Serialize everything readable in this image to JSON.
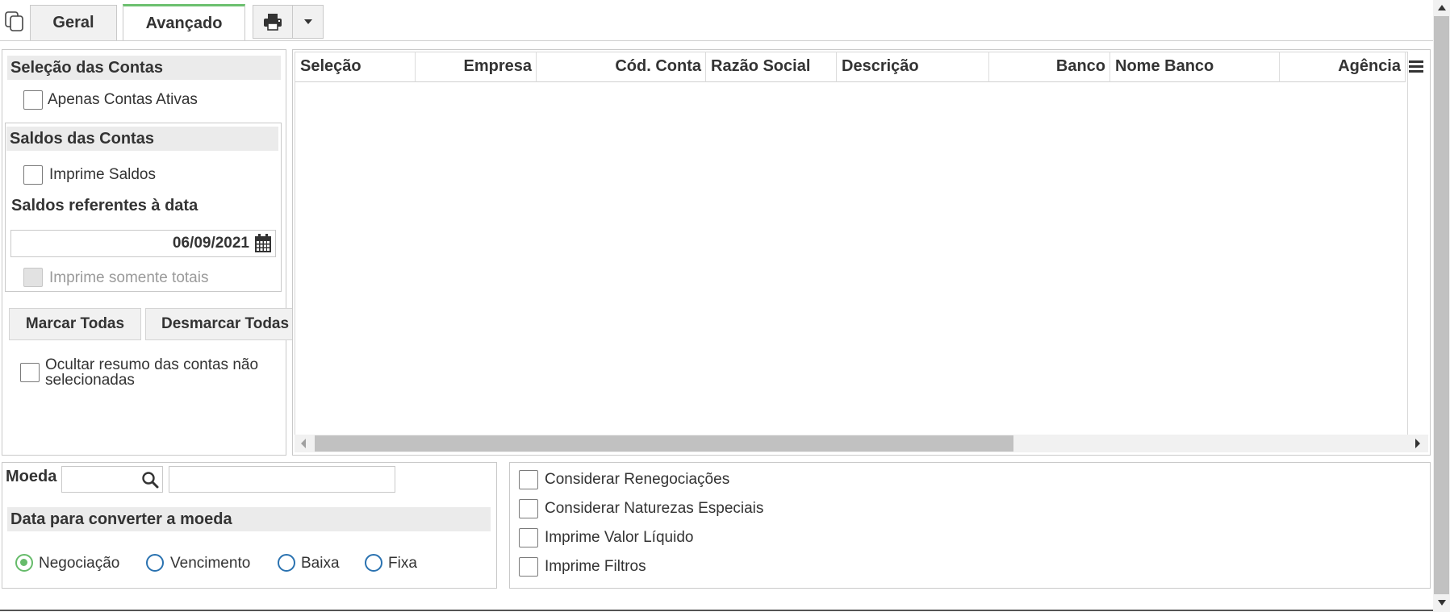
{
  "tabs": [
    {
      "label": "Geral",
      "active": false
    },
    {
      "label": "Avançado",
      "active": true
    }
  ],
  "accent_color": "#6cc06f",
  "toolbar": {
    "print_icon": "printer-icon",
    "dropdown_icon": "caret-down-icon"
  },
  "left_panel": {
    "accounts_section": "Seleção das Contas",
    "only_active_label": "Apenas Contas Ativas",
    "balances_section": "Saldos das Contas",
    "print_balances_label": "Imprime Saldos",
    "balances_date_label": "Saldos referentes à data",
    "balances_date_value": "06/09/2021",
    "print_totals_label": "Imprime somente totais",
    "select_all_button": "Marcar Todas",
    "deselect_all_button": "Desmarcar Todas",
    "hide_summary_label_line1": "Ocultar resumo das contas não",
    "hide_summary_label_line2": "selecionadas"
  },
  "grid": {
    "columns": [
      "Seleção",
      "Empresa",
      "Cód. Conta",
      "Razão Social",
      "Descrição",
      "Banco",
      "Nome Banco",
      "Agência"
    ],
    "rows": []
  },
  "currency": {
    "label": "Moeda",
    "code_value": "",
    "description_value": "",
    "conversion_date_section": "Data para converter a moeda",
    "radios": [
      {
        "label": "Negociação",
        "selected": true
      },
      {
        "label": "Vencimento",
        "selected": false
      },
      {
        "label": "Baixa",
        "selected": false
      },
      {
        "label": "Fixa",
        "selected": false
      }
    ]
  },
  "options": [
    {
      "label": "Considerar Renegociações",
      "checked": false
    },
    {
      "label": "Considerar Naturezas Especiais",
      "checked": false
    },
    {
      "label": "Imprime Valor Líquido",
      "checked": false
    },
    {
      "label": "Imprime Filtros",
      "checked": false
    }
  ]
}
